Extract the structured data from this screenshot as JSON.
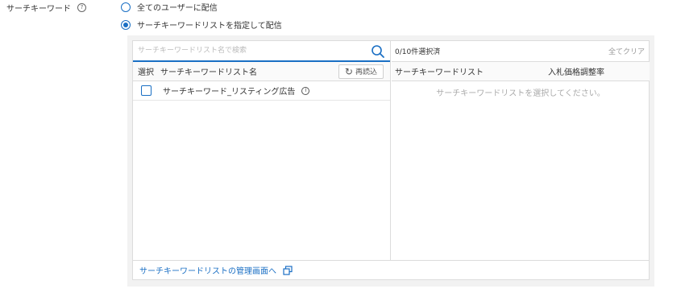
{
  "field": {
    "label": "サーチキーワード",
    "help_icon": "?"
  },
  "delivery_options": [
    {
      "label": "全てのユーザーに配信",
      "checked": false
    },
    {
      "label": "サーチキーワードリストを指定して配信",
      "checked": true
    }
  ],
  "left_panel": {
    "search_placeholder": "サーチキーワードリスト名で検索",
    "col_select": "選択",
    "col_name": "サーチキーワードリスト名",
    "reload_label": "再読込",
    "rows": [
      {
        "label": "サーチキーワード_リスティング広告",
        "checked": false
      }
    ]
  },
  "right_panel": {
    "count": "0/10件選択済",
    "clear_all": "全てクリア",
    "col_name": "サーチキーワードリスト",
    "col_bid": "入札価格調整率",
    "empty_message": "サーチキーワードリストを選択してください。"
  },
  "footer": {
    "link": "サーチキーワードリストの管理画面へ"
  },
  "colors": {
    "accent": "#1a6fc4",
    "border": "#dcdcdc",
    "muted": "#aaaaaa"
  },
  "icons": {
    "help": "help-circle-icon",
    "search": "search-icon",
    "reload": "reload-icon",
    "info": "info-icon",
    "external": "external-link-icon"
  }
}
